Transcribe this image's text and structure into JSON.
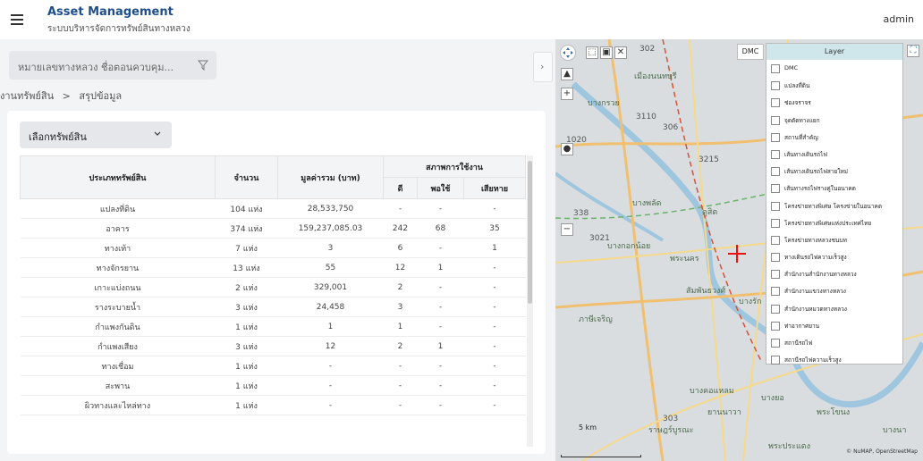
{
  "header": {
    "title": "Asset Management",
    "subtitle": "ระบบบริหารจัดการทรัพย์สินทางหลวง",
    "user": "admin"
  },
  "search": {
    "placeholder": "หมายเลขทางหลวง ชื่อตอนควบคุม..."
  },
  "breadcrumb": {
    "items": [
      "งานทรัพย์สิน",
      ">",
      "สรุปข้อมูล"
    ]
  },
  "asset_select": {
    "value": "เลือกทรัพย์สิน"
  },
  "table": {
    "headers": {
      "type": "ประเภททรัพย์สิน",
      "count": "จำนวน",
      "total_value": "มูลค่ารวม (บาท)",
      "status": "สภาพการใช้งาน",
      "good": "ดี",
      "fair": "พอใช้",
      "damaged": "เสียหาย"
    },
    "rows": [
      {
        "type": "แปลงที่ดิน",
        "count": "104 แห่ง",
        "value": "28,533,750",
        "good": "-",
        "fair": "-",
        "damaged": "-"
      },
      {
        "type": "อาคาร",
        "count": "374 แห่ง",
        "value": "159,237,085.03",
        "good": "242",
        "fair": "68",
        "damaged": "35"
      },
      {
        "type": "ทางเท้า",
        "count": "7 แห่ง",
        "value": "3",
        "good": "6",
        "fair": "-",
        "damaged": "1"
      },
      {
        "type": "ทางจักรยาน",
        "count": "13 แห่ง",
        "value": "55",
        "good": "12",
        "fair": "1",
        "damaged": "-"
      },
      {
        "type": "เกาะแบ่งถนน",
        "count": "2 แห่ง",
        "value": "329,001",
        "good": "2",
        "fair": "-",
        "damaged": "-"
      },
      {
        "type": "รางระบายน้ำ",
        "count": "3 แห่ง",
        "value": "24,458",
        "good": "3",
        "fair": "-",
        "damaged": "-"
      },
      {
        "type": "กำแพงกันดิน",
        "count": "1 แห่ง",
        "value": "1",
        "good": "1",
        "fair": "-",
        "damaged": "-"
      },
      {
        "type": "กำแพงเสียง",
        "count": "3 แห่ง",
        "value": "12",
        "good": "2",
        "fair": "1",
        "damaged": "-"
      },
      {
        "type": "ทางเชื่อม",
        "count": "1 แห่ง",
        "value": "-",
        "good": "-",
        "fair": "-",
        "damaged": "-"
      },
      {
        "type": "สะพาน",
        "count": "1 แห่ง",
        "value": "-",
        "good": "-",
        "fair": "-",
        "damaged": "-"
      },
      {
        "type": "ผิวทางและไหล่ทาง",
        "count": "1 แห่ง",
        "value": "-",
        "good": "-",
        "fair": "-",
        "damaged": "-"
      }
    ]
  },
  "map": {
    "dmc_label": "DMC",
    "layer_title": "Layer",
    "layers": [
      "DMC",
      "แปลงที่ดิน",
      "ช่องจราจร",
      "จุดตัดทางแยก",
      "สถานที่สำคัญ",
      "เส้นทางเดินรถไฟ",
      "เส้นทางเดินรถไฟสายใหม่",
      "เส้นทางรถไฟรางคู่ในอนาคต",
      "โครงข่ายทางพิเศษ โครงข่ายในอนาคต",
      "โครงข่ายทางพิเศษแห่งประเทศไทย",
      "โครงข่ายทางหลวงชนบท",
      "ทางเดินรถไฟความเร็วสูง",
      "สำนักงานสำนักงานทางหลวง",
      "สำนักงานแขวงทางหลวง",
      "สำนักงานหมวดทางหลวง",
      "ท่าอากาศยาน",
      "สถานีรถไฟ",
      "สถานีรถไฟความเร็วสูง"
    ],
    "place_labels": [
      "เมืองนนทบุรี",
      "บางกรวย",
      "บางพลัด",
      "ดุสิต",
      "บางกอกน้อย",
      "พระนคร",
      "สัมพันธวงศ์",
      "บางรัก",
      "ภาษีเจริญ",
      "บางคอแหลม",
      "ยานนาวา",
      "ราษฎร์บูรณะ",
      "พระประแดง",
      "บางยอ",
      "พระโขนง",
      "บางนา"
    ],
    "route_labels": [
      "302",
      "3110",
      "306",
      "1020",
      "3215",
      "338",
      "3021",
      "303"
    ],
    "scale": "5 km",
    "attribution": "© NuMAP, OpenStreetMap"
  }
}
